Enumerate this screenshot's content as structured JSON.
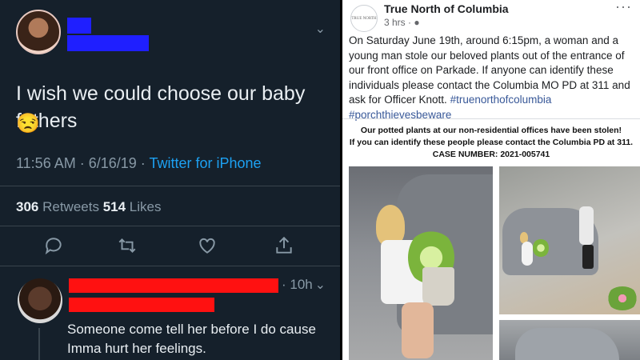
{
  "tweet": {
    "text": "I wish we could choose our baby fathers",
    "emoji": "😒",
    "time": "11:56 AM · 6/16/19 · ",
    "client": "Twitter for iPhone",
    "retweets_count": "306",
    "retweets_label": " Retweets  ",
    "likes_count": "514",
    "likes_label": " Likes",
    "icons": [
      "reply-icon",
      "retweet-icon",
      "like-icon",
      "share-icon"
    ]
  },
  "reply": {
    "time": "· 10h",
    "text_line1": "Someone come tell her before I do cause",
    "text_line2": "Imma hurt her feelings."
  },
  "facebook": {
    "page_name": "True North of Columbia",
    "logo_text": "TRUE NORTH",
    "timestamp": "3 hrs · ",
    "post_text": "On Saturday June 19th, around 6:15pm, a woman and a young man stole our beloved plants out of the entrance of our front office on Parkade. If anyone can identify these individuals please contact the Columbia MO PD at 311 and ask for Officer Knott. ",
    "hashtag1": "#truenorthofcolumbia",
    "hashtag2": "#porchthievesbeware",
    "notice_line1": "Our potted plants at our non-residential offices have been stolen!",
    "notice_line2": "If you can identify these people please contact the Columbia PD at 311.",
    "notice_line3": "CASE NUMBER: 2021-005741"
  },
  "colors": {
    "twitter_bg": "#15202b",
    "twitter_link": "#1da1f2",
    "redaction_blue": "#1f1fff",
    "redaction_red": "#ff1111",
    "facebook_link": "#385898"
  }
}
